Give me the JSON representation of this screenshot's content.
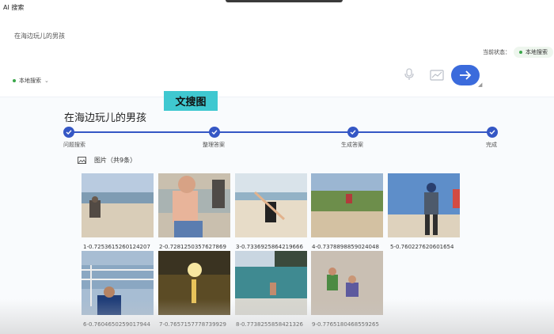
{
  "app": {
    "title": "AI 搜索"
  },
  "search": {
    "query": "在海边玩儿的男孩",
    "status_label": "当前状态：",
    "status_value": "本地搜索",
    "scope_label": "本地搜索"
  },
  "overlay": {
    "highlight_text": "文搜图"
  },
  "result": {
    "title": "在海边玩儿的男孩",
    "steps": [
      "问题搜索",
      "整理答案",
      "生成答案",
      "完成"
    ],
    "images_label": "图片（共9条）"
  },
  "images": [
    {
      "caption": "1-0.7253615260124207"
    },
    {
      "caption": "2-0.7281250357627869"
    },
    {
      "caption": "3-0.7336925864219666"
    },
    {
      "caption": "4-0.7378898859024048"
    },
    {
      "caption": "5-0.760227620601654"
    },
    {
      "caption": "6-0.7604650259017944"
    },
    {
      "caption": "7-0.7657157778739929"
    },
    {
      "caption": "8-0.7738255858421326"
    },
    {
      "caption": "9-0.7765180468559265"
    }
  ],
  "colors": {
    "accent": "#3557c5",
    "send_button": "#3b6bdc",
    "highlight": "#3fc8d0",
    "status_dot": "#3aa64a"
  }
}
